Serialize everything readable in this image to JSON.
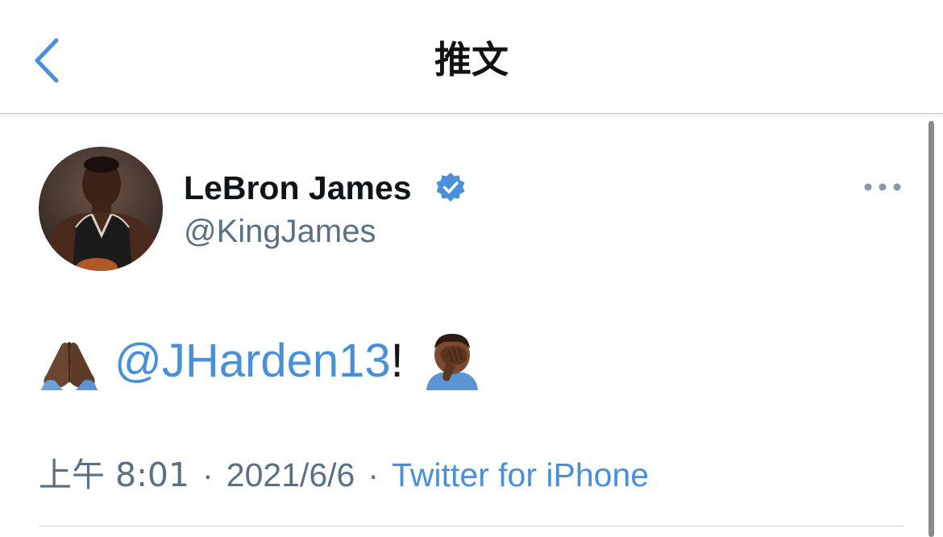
{
  "nav": {
    "back_icon": "chevron-left-icon",
    "title": "推文"
  },
  "tweet": {
    "author": {
      "display_name": "LeBron James",
      "handle": "@KingJames",
      "verified": true,
      "avatar_icon": "avatar-photo"
    },
    "more_icon": "ellipsis-icon",
    "body": {
      "leading_emoji": "folded-hands-emoji",
      "mention": "@JHarden13",
      "punctuation": "!",
      "trailing_emoji": "face-palm-emoji"
    },
    "meta": {
      "time": "上午 8:01",
      "separator": "·",
      "date": "2021/6/6",
      "source": "Twitter for iPhone"
    }
  },
  "colors": {
    "accent": "#4a90d9",
    "verified": "#4a90d9",
    "secondary_text": "#5b7083",
    "primary_text": "#0f1419"
  }
}
